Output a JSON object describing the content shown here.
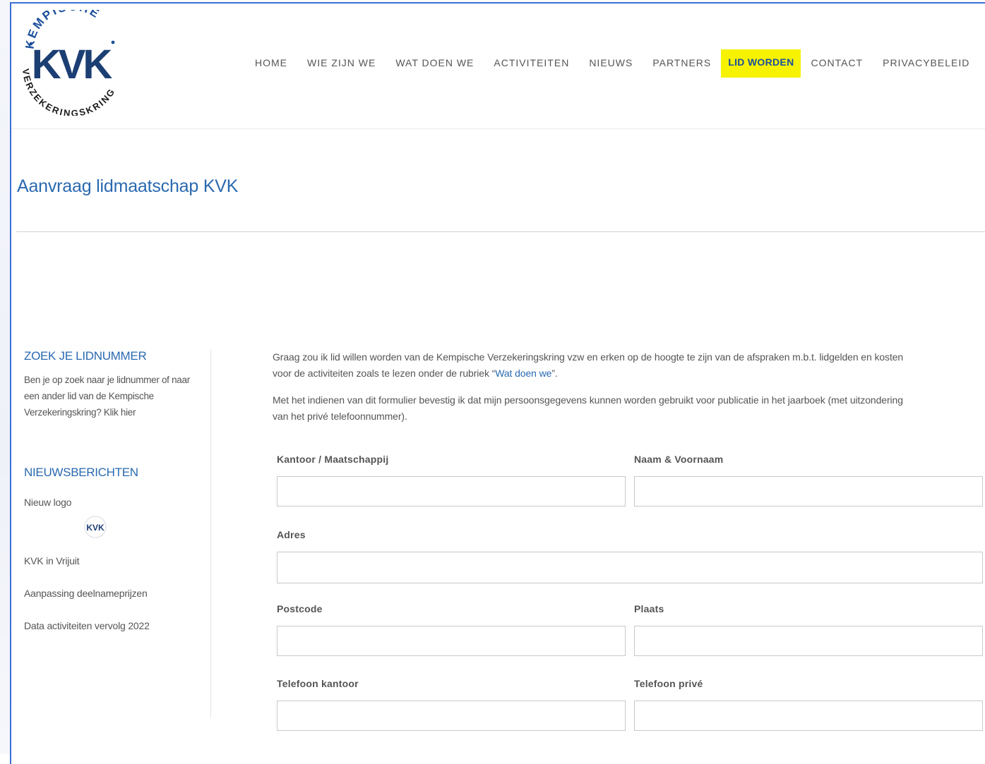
{
  "brand": {
    "logo_top_text": "KEMPISCHE",
    "logo_initials": "KVK",
    "logo_bottom_text": "VERZEKERINGSKRING"
  },
  "nav": {
    "items": [
      {
        "label": "HOME"
      },
      {
        "label": "WIE ZIJN WE"
      },
      {
        "label": "WAT DOEN WE"
      },
      {
        "label": "ACTIVITEITEN"
      },
      {
        "label": "NIEUWS"
      },
      {
        "label": "PARTNERS"
      },
      {
        "label": "LID WORDEN"
      },
      {
        "label": "CONTACT"
      },
      {
        "label": "PRIVACYBELEID"
      }
    ],
    "active_color": "#f6f200"
  },
  "page": {
    "title": "Aanvraag lidmaatschap KVK"
  },
  "sidebar": {
    "search_heading": "ZOEK JE LIDNUMMER",
    "search_text": "Ben je op zoek naar je lidnummer of naar een ander lid van de Kempische Verzekeringskring? Klik hier",
    "news_heading": "NIEUWSBERICHTEN",
    "news": [
      {
        "title": "Nieuw logo"
      },
      {
        "title": "KVK in Vrijuit"
      },
      {
        "title": "Aanpassing deelnameprijzen"
      },
      {
        "title": "Data activiteiten vervolg 2022"
      }
    ]
  },
  "intro": {
    "p1_line1": "Graag zou ik lid willen worden van de Kempische Verzekeringskring vzw en erken op de hoogte te zijn van de afspraken m.b.t. lidgelden en kosten",
    "p1_line2_before": "voor de activiteiten zoals te lezen onder de rubriek “",
    "p1_link": "Wat doen we",
    "p1_line2_after": "”.",
    "p2_line1": "Met het indienen van dit formulier bevestig ik dat mijn persoonsgegevens kunnen worden gebruikt voor publicatie in het jaarboek (met uitzondering",
    "p2_line2": "van het privé telefoonnummer)."
  },
  "form": {
    "kantoor": {
      "label": "Kantoor / Maatschappij",
      "value": ""
    },
    "naam": {
      "label": "Naam & Voornaam",
      "value": ""
    },
    "adres": {
      "label": "Adres",
      "value": ""
    },
    "postcode": {
      "label": "Postcode",
      "value": ""
    },
    "plaats": {
      "label": "Plaats",
      "value": ""
    },
    "tel_kantoor": {
      "label": "Telefoon kantoor",
      "value": ""
    },
    "tel_prive": {
      "label": "Telefoon privé",
      "value": ""
    }
  },
  "colors": {
    "accent": "#2a69b0",
    "logo_blue": "#1c4f9c",
    "frame_border": "#3b6fd6"
  }
}
